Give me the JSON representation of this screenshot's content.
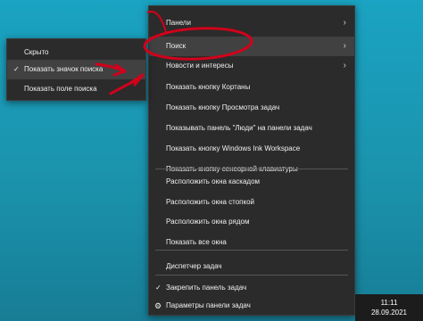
{
  "context_menu": {
    "items": [
      {
        "label": "Панели",
        "arrow": "›"
      },
      {
        "label": "Поиск",
        "arrow": "›"
      },
      {
        "label": "Новости и интересы",
        "arrow": "›"
      },
      {
        "label": "Показать кнопку Кортаны"
      },
      {
        "label": "Показать кнопку Просмотра задач"
      },
      {
        "label": "Показывать панель \"Люди\" на панели задач"
      },
      {
        "label": "Показать кнопку Windows Ink Workspace"
      },
      {
        "label": "Показать кнопку сенсорной клавиатуры"
      },
      {
        "label": "Расположить окна каскадом"
      },
      {
        "label": "Расположить окна стопкой"
      },
      {
        "label": "Расположить окна рядом"
      },
      {
        "label": "Показать все окна"
      },
      {
        "label": "Диспетчер задач"
      },
      {
        "label": "Закрепить панель задач",
        "check": "✓"
      },
      {
        "label": "Параметры панели задач",
        "icon": "⚙"
      }
    ]
  },
  "search_submenu": {
    "items": [
      {
        "label": "Скрыто"
      },
      {
        "label": "Показать значок поиска",
        "check": "✓"
      },
      {
        "label": "Показать поле поиска"
      }
    ]
  },
  "clock": {
    "time": "11:11",
    "date": "28.09.2021"
  },
  "colors": {
    "menu_bg": "#2b2b2b",
    "highlight": "#414141",
    "annotation": "#d0021b",
    "desktop": "#1aa3c2"
  }
}
